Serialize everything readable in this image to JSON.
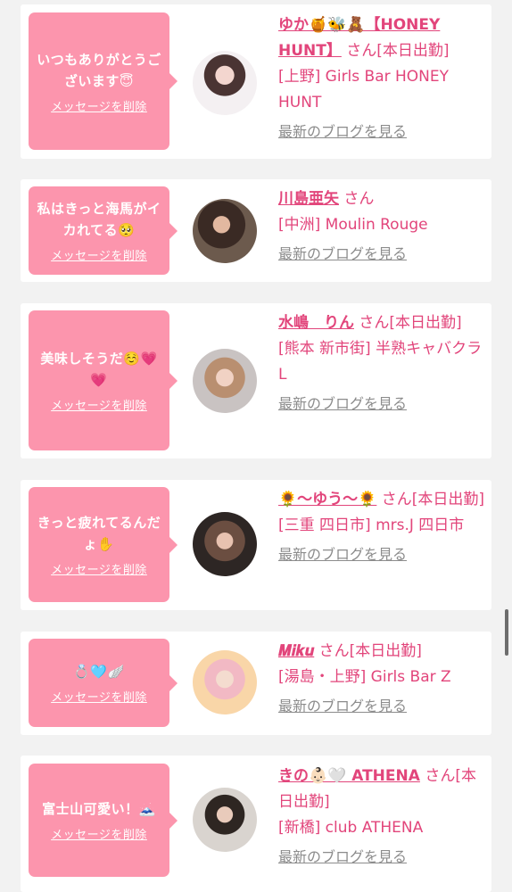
{
  "common": {
    "delete_label": "メッセージを削除",
    "blog_label": "最新のブログを見る",
    "san": "さん"
  },
  "cards": [
    {
      "message": "いつもありがとうございます😇",
      "name": "ゆか🍯🐝🧸【HONEY HUNT】",
      "status": "[本日出勤]",
      "shop": "[上野] Girls Bar HONEY HUNT"
    },
    {
      "message": "私はきっと海馬がイカれてる🥺",
      "name": "川島亜矢",
      "status": "",
      "shop": "[中洲] Moulin Rouge"
    },
    {
      "message": "美味しそうだ☺️💗💗",
      "name": "水嶋　りん",
      "status": "[本日出勤]",
      "shop": "[熊本 新市街] 半熟キャバクラ L"
    },
    {
      "message": "きっと疲れてるんだょ✋",
      "name": "🌻〜ゆう〜🌻",
      "status": "[本日出勤]",
      "shop": "[三重 四日市] mrs.J 四日市"
    },
    {
      "message": "💍🩵🪽",
      "name": "𝑴𝒊𝒌𝒖",
      "status": "[本日出勤]",
      "shop": "[湯島・上野] Girls Bar Z"
    },
    {
      "message": "富士山可愛い！🗻",
      "name": "きの👶🏻🤍 ATHENA",
      "status": "[本日出勤]",
      "shop": "[新橋] club ATHENA"
    }
  ]
}
